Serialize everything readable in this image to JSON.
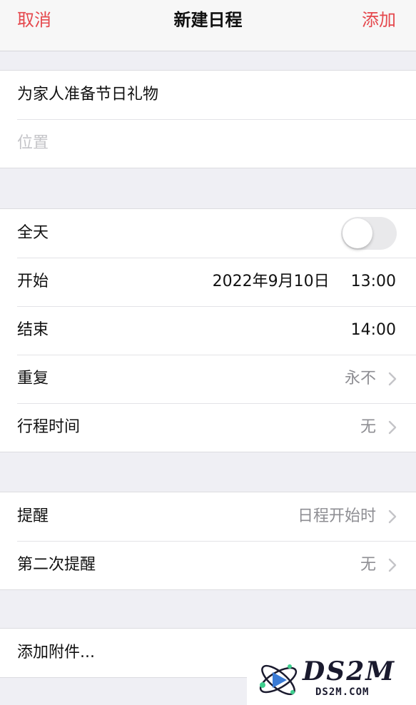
{
  "navbar": {
    "cancel_label": "取消",
    "title": "新建日程",
    "add_label": "添加"
  },
  "event": {
    "title": "为家人准备节日礼物",
    "location_placeholder": "位置"
  },
  "time_group": {
    "all_day_label": "全天",
    "all_day_on": false,
    "start_label": "开始",
    "start_date": "2022年9月10日",
    "start_time": "13:00",
    "end_label": "结束",
    "end_time": "14:00",
    "repeat_label": "重复",
    "repeat_value": "永不",
    "travel_label": "行程时间",
    "travel_value": "无"
  },
  "alert_group": {
    "alert_label": "提醒",
    "alert_value": "日程开始时",
    "second_alert_label": "第二次提醒",
    "second_alert_value": "无"
  },
  "attachment": {
    "label": "添加附件..."
  },
  "watermark": {
    "main": "DS2M",
    "sub": "DS2M.COM"
  },
  "colors": {
    "accent": "#e5484d",
    "muted": "#8e8e93",
    "background": "#efeff4"
  }
}
